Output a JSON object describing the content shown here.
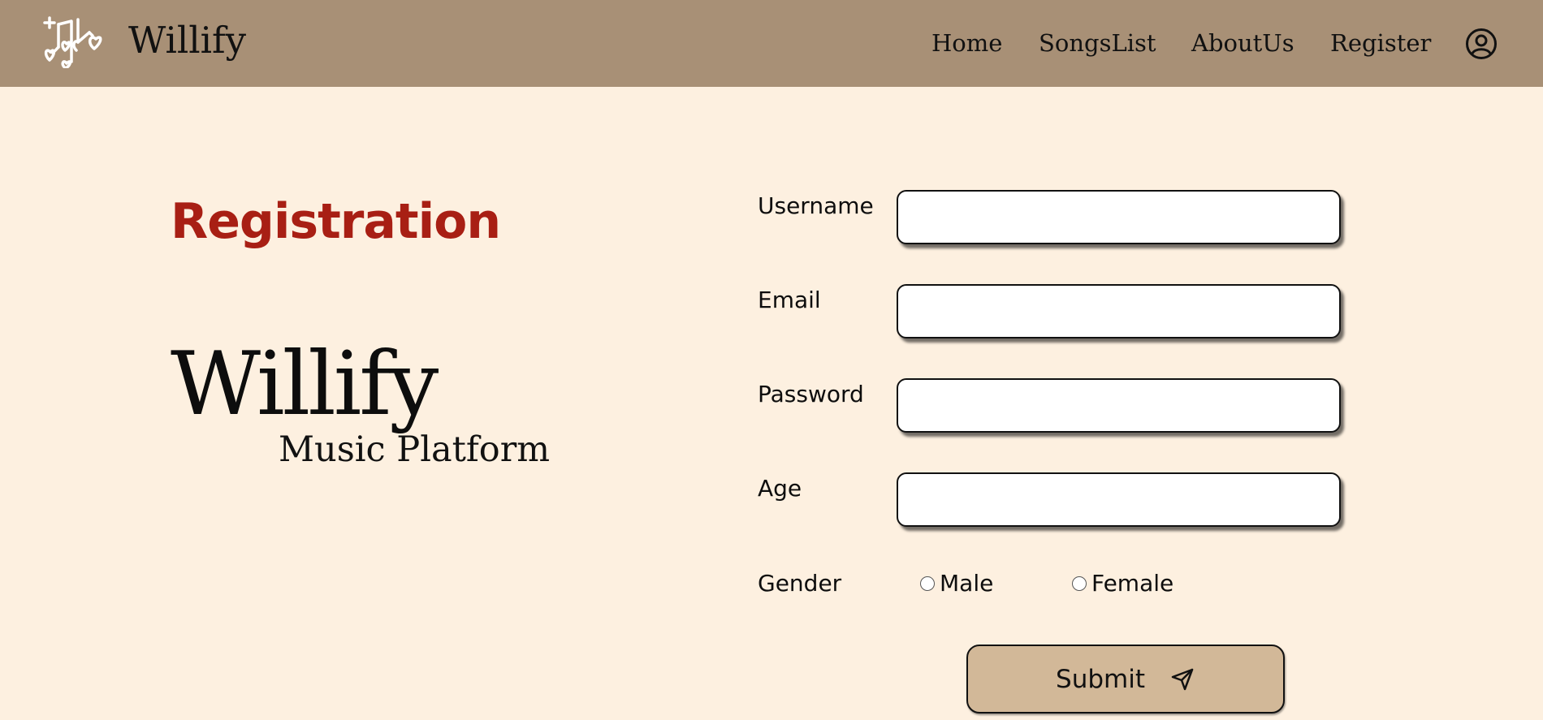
{
  "header": {
    "brand_name": "Willify",
    "logo_icon": "music-notes-hearts-icon",
    "nav": {
      "home": "Home",
      "songs_list": "SongsList",
      "about_us": "AboutUs",
      "register": "Register"
    },
    "profile_icon": "user-circle-icon"
  },
  "hero": {
    "title": "Registration",
    "logo_wordmark": "Willify",
    "logo_tagline": "Music Platform"
  },
  "form": {
    "username_label": "Username",
    "email_label": "Email",
    "password_label": "Password",
    "age_label": "Age",
    "gender_label": "Gender",
    "gender_options": {
      "male": "Male",
      "female": "Female"
    },
    "username_value": "",
    "email_value": "",
    "password_value": "",
    "age_value": "",
    "submit_label": "Submit",
    "submit_icon": "send-icon"
  },
  "colors": {
    "navbar_bg": "#a89076",
    "page_bg": "#fdf0e0",
    "title_red": "#a81f14",
    "button_bg": "#d2b898"
  }
}
